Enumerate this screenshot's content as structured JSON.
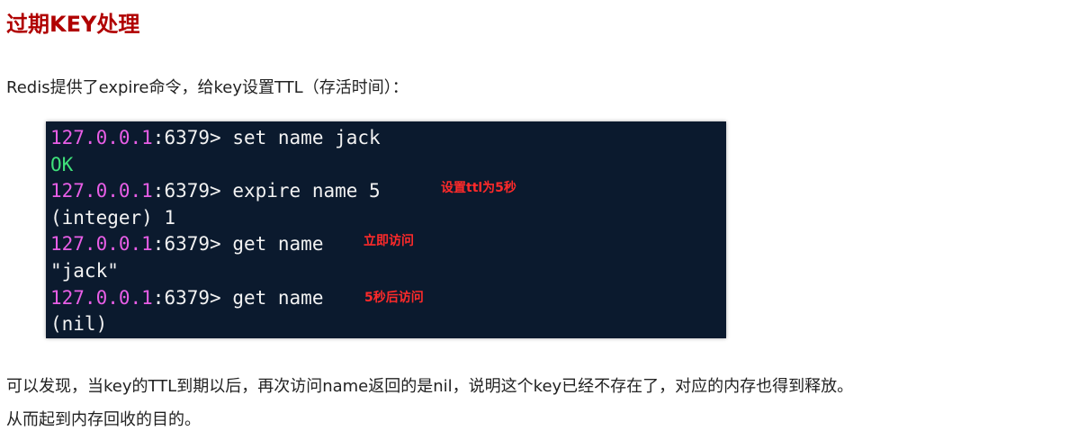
{
  "heading": "过期KEY处理",
  "intro": "Redis提供了expire命令，给key设置TTL（存活时间）：",
  "terminal": {
    "prompt_ip": "127.0.0.1",
    "prompt_rest": ":6379> ",
    "lines": [
      {
        "command": "set name jack"
      },
      {
        "output": "OK"
      },
      {
        "command": "expire name 5",
        "note": "设置ttl为5秒"
      },
      {
        "output": "(integer) 1"
      },
      {
        "command": "get name",
        "note": "立即访问"
      },
      {
        "output": "\"jack\""
      },
      {
        "command": "get name",
        "note": "5秒后访问"
      },
      {
        "output": "(nil)"
      }
    ]
  },
  "colors": {
    "heading": "#b00000",
    "terminal_bg": "#0b1a2e",
    "prompt_ip": "#e85ee6",
    "ok": "#3fe07a",
    "note": "#ff2a2a"
  },
  "conclusion": {
    "line1": "可以发现，当key的TTL到期以后，再次访问name返回的是nil，说明这个key已经不存在了，对应的内存也得到释放。",
    "line2": "从而起到内存回收的目的。"
  }
}
